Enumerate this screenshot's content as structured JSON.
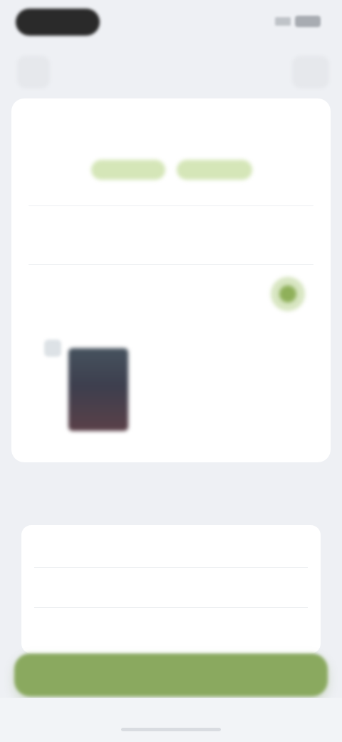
{
  "status_bar": {
    "time": "",
    "icons": [
      "signal-icon",
      "battery-icon"
    ]
  },
  "header": {
    "back_icon": "chevron-left-icon",
    "title": "",
    "more_icon": "more-icon"
  },
  "delivery": {
    "label": "",
    "option_one": "",
    "option_two": ""
  },
  "address": {
    "label": "",
    "line": ""
  },
  "toggle_row": {
    "label": "",
    "selected": true
  },
  "product": {
    "title": "",
    "subtitle": "",
    "price": ""
  },
  "payment_section": {
    "title": "",
    "rows": [
      {
        "label": "",
        "value": ""
      },
      {
        "label": "",
        "value": ""
      },
      {
        "label": "",
        "value": ""
      }
    ]
  },
  "checkout": {
    "label": ""
  },
  "colors": {
    "accent": "#8aa95f",
    "accent_light": "#d5e6b8",
    "background": "#eef0f4",
    "card": "#ffffff"
  }
}
